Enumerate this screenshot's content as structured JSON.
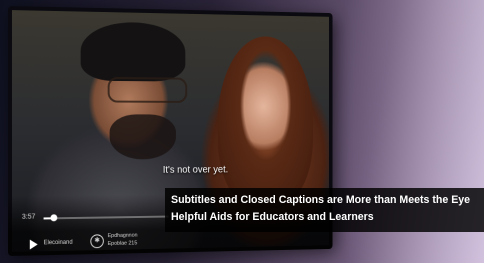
{
  "video": {
    "subtitle_text": "It's not over yet.",
    "time_elapsed": "3:57",
    "progress_fraction": 0.08,
    "control_label": "Elecoinand",
    "meta_line_1": "Epdhagnnon",
    "meta_line_2": "Epoblae 215"
  },
  "headline": {
    "line_1": "Subtitles and Closed Captions are More than Meets the Eye",
    "line_2": "Helpful Aids for Educators and Learners"
  },
  "icons": {
    "play": "play-icon",
    "captions": "captions-icon"
  }
}
